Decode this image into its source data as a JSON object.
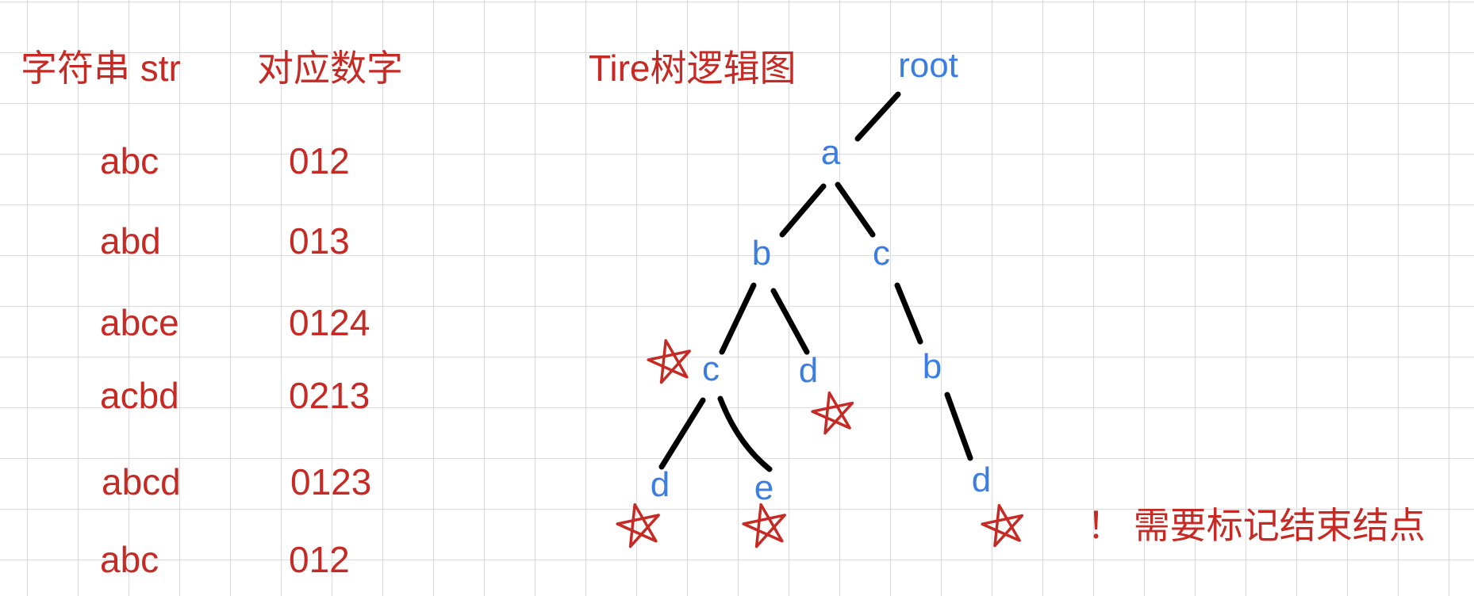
{
  "table": {
    "col_string_header": "字符串 str",
    "col_number_header": "对应数字",
    "rows": [
      {
        "string": "abc",
        "number": "012"
      },
      {
        "string": "abd",
        "number": "013"
      },
      {
        "string": "abce",
        "number": "0124"
      },
      {
        "string": "acbd",
        "number": "0213"
      },
      {
        "string": "abcd",
        "number": "0123"
      },
      {
        "string": "abc",
        "number": "012"
      }
    ]
  },
  "tree": {
    "title": "Tire树逻辑图",
    "nodes": {
      "root": "root",
      "a": "a",
      "b": "b",
      "c": "c",
      "bc": "c",
      "bd": "d",
      "cb": "b",
      "bcd": "d",
      "bce": "e",
      "cbd": "d"
    },
    "end_marker_icon": "star-icon",
    "end_marked_nodes": [
      "bc",
      "bd",
      "bcd",
      "bce",
      "cbd"
    ]
  },
  "note": "！ 需要标记结束结点",
  "colors": {
    "text_red": "#c62a24",
    "node_blue": "#3b7ee0",
    "edge_black": "#000000",
    "star_red": "#c62a24",
    "grid": "#dcdcdc"
  }
}
